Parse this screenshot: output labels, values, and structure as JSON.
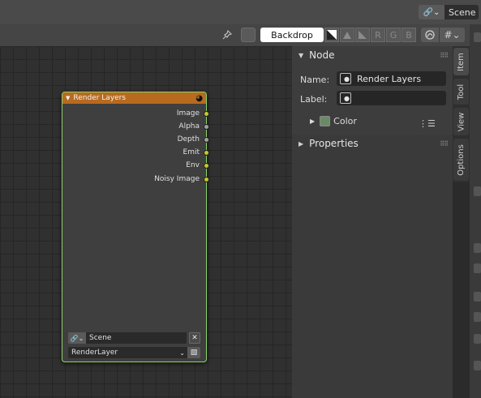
{
  "topbar": {
    "scene_icon": "🔗⌄",
    "scene_name": "Scene"
  },
  "header": {
    "backdrop_label": "Backdrop",
    "channels": [
      "R",
      "G",
      "B"
    ],
    "grid_symbol": "#⌄"
  },
  "node": {
    "title": "Render Layers",
    "outputs": [
      {
        "label": "Image",
        "type": "color"
      },
      {
        "label": "Alpha",
        "type": "value"
      },
      {
        "label": "Depth",
        "type": "value"
      },
      {
        "label": "Emit",
        "type": "color"
      },
      {
        "label": "Env",
        "type": "color"
      },
      {
        "label": "Noisy Image",
        "type": "color"
      }
    ],
    "scene_value": "Scene",
    "layer_value": "RenderLayer"
  },
  "sidebar": {
    "node_panel_title": "Node",
    "name_label": "Name:",
    "name_value": "Render Layers",
    "label_label": "Label:",
    "label_value": "",
    "color_label": "Color",
    "properties_title": "Properties"
  },
  "tabs": {
    "item": "Item",
    "tool": "Tool",
    "view": "View",
    "options": "Options"
  },
  "colors": {
    "node_header": "#b86a1f",
    "node_border": "#8bd36a",
    "socket_color": "#c7c729",
    "socket_value": "#a1a1a1"
  }
}
